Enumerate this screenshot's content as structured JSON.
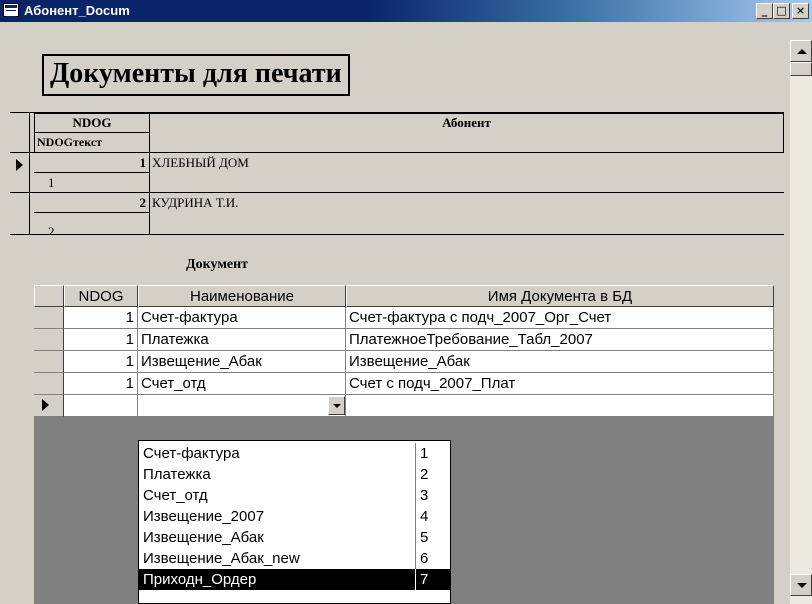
{
  "window": {
    "title": "Абонент_Docum",
    "min_label": "_",
    "max_label": "□",
    "close_label": "×"
  },
  "form": {
    "title": "Документы для печати"
  },
  "master": {
    "col_ndog": "NDOG",
    "col_ndog_text": "NDOGтекст",
    "col_abonent": "Абонент",
    "rows": [
      {
        "ndog": "1",
        "name": "ХЛЕБНЫЙ ДОМ",
        "ndog_text": "1"
      },
      {
        "ndog": "2",
        "name": "КУДРИНА Т.И.",
        "ndog_text": "2"
      }
    ]
  },
  "subform": {
    "title": "Документ",
    "columns": [
      "NDOG",
      "Наименование",
      "Имя Документа в БД"
    ],
    "rows": [
      {
        "ndog": "1",
        "name": "Счет-фактура",
        "dbname": "Счет-фактура с подч_2007_Орг_Счет"
      },
      {
        "ndog": "1",
        "name": "Платежка",
        "dbname": "ПлатежноеТребование_Табл_2007"
      },
      {
        "ndog": "1",
        "name": "Извещение_Абак",
        "dbname": "Извещение_Абак"
      },
      {
        "ndog": "1",
        "name": "Счет_отд",
        "dbname": "Счет с подч_2007_Плат"
      }
    ]
  },
  "dropdown": {
    "items": [
      {
        "name": "Счет-фактура",
        "id": "1"
      },
      {
        "name": "Платежка",
        "id": "2"
      },
      {
        "name": "Счет_отд",
        "id": "3"
      },
      {
        "name": "Извещение_2007",
        "id": "4"
      },
      {
        "name": "Извещение_Абак",
        "id": "5"
      },
      {
        "name": "Извещение_Абак_new",
        "id": "6"
      },
      {
        "name": "Приходн_Ордер",
        "id": "7"
      }
    ],
    "selected_index": 6
  }
}
